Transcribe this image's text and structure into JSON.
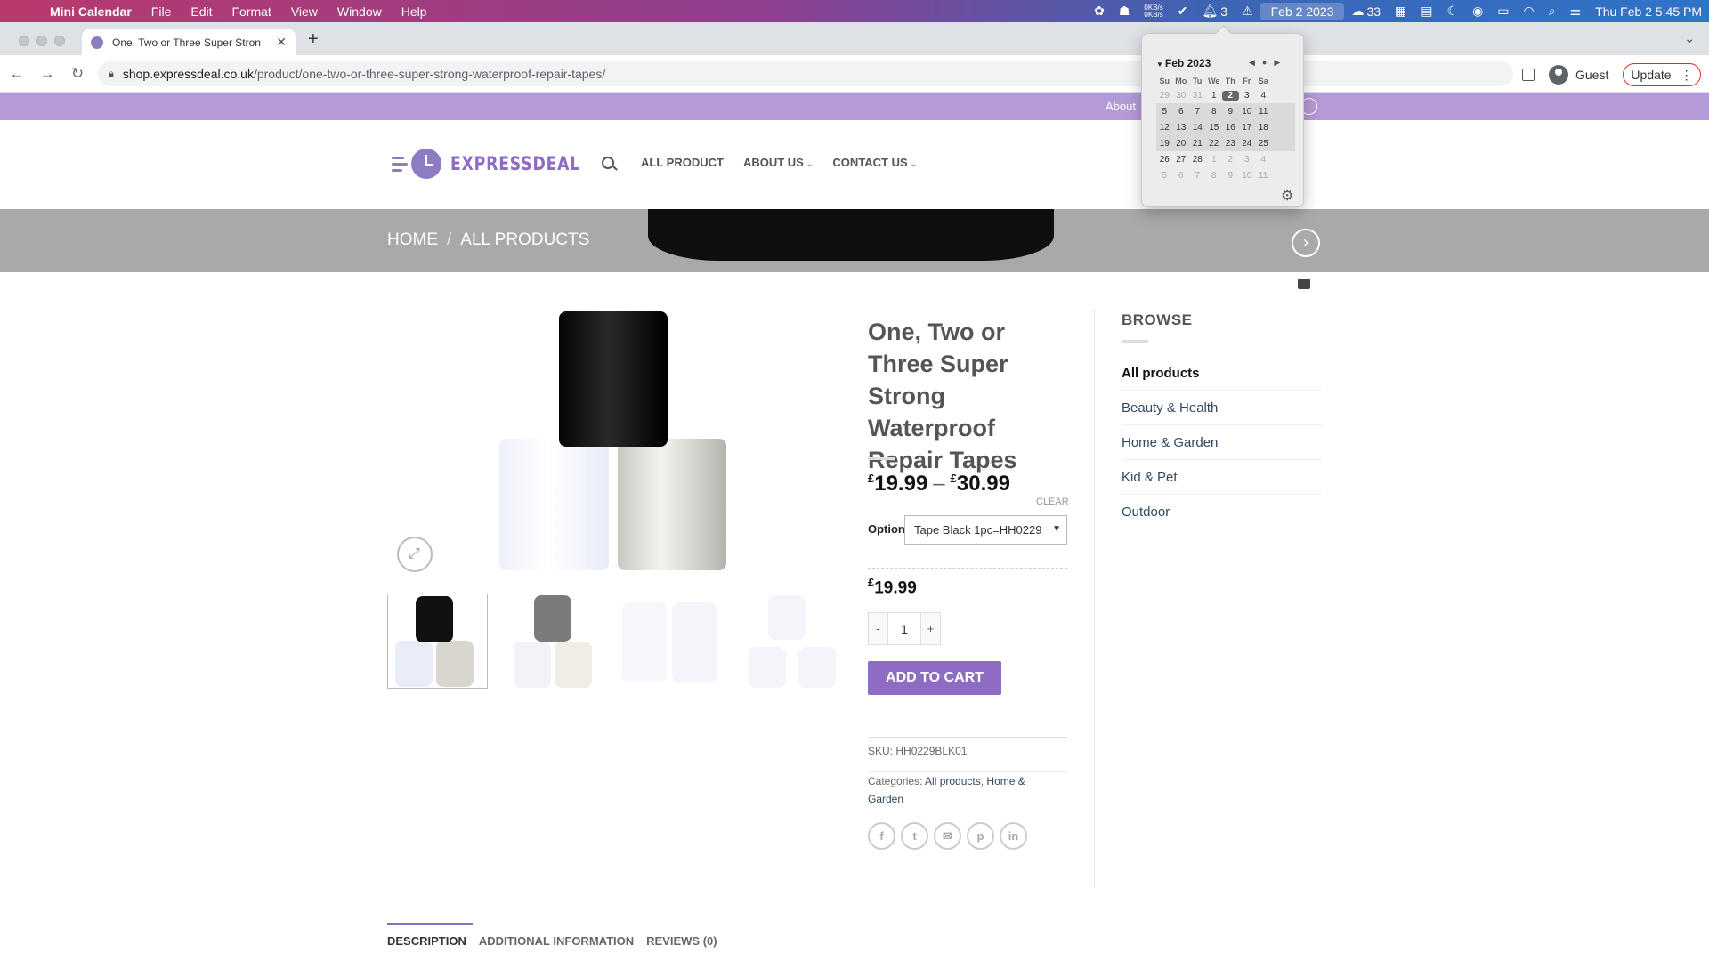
{
  "menubar": {
    "app": "Mini Calendar",
    "menus": [
      "File",
      "Edit",
      "Format",
      "View",
      "Window",
      "Help"
    ],
    "net_up": "0KB/s",
    "net_down": "0KB/s",
    "notif_count": "3",
    "date_chip": "Feb 2 2023",
    "wechat_count": "33",
    "clock": "Thu Feb 2  5:45 PM"
  },
  "browser": {
    "tab_title": "One, Two or Three Super Stron",
    "url_host": "shop.expressdeal.co.uk",
    "url_path": "/product/one-two-or-three-super-strong-waterproof-repair-tapes/",
    "profile": "Guest",
    "update": "Update"
  },
  "site": {
    "topbar_about": "About",
    "logo_text": "EXPRESSDEAL",
    "nav": [
      "ALL PRODUCT",
      "ABOUT US",
      "CONTACT US"
    ],
    "breadcrumb": [
      "HOME",
      "ALL PRODUCTS"
    ]
  },
  "product": {
    "title": "One, Two or Three Super Strong Waterproof Repair Tapes",
    "currency": "£",
    "price_min": "19.99",
    "price_sep": "–",
    "price_max": "30.99",
    "clear": "CLEAR",
    "option_label": "Option",
    "option_selected": "Tape Black 1pc=HH0229",
    "selected_price": "19.99",
    "qty_minus": "-",
    "qty": "1",
    "qty_plus": "+",
    "add_to_cart": "ADD TO CART",
    "sku_label": "SKU:",
    "sku": "HH0229BLK01",
    "categories_label": "Categories:",
    "categories": [
      "All products",
      "Home &",
      "Garden"
    ],
    "share": [
      "f",
      "t",
      "✉",
      "p",
      "in"
    ]
  },
  "sidebar": {
    "title": "BROWSE",
    "items": [
      "All products",
      "Beauty & Health",
      "Home & Garden",
      "Kid & Pet",
      "Outdoor"
    ]
  },
  "tabs": [
    "DESCRIPTION",
    "ADDITIONAL INFORMATION",
    "REVIEWS (0)"
  ],
  "calendar": {
    "month": "Feb 2023",
    "weekdays": [
      "Su",
      "Mo",
      "Tu",
      "We",
      "Th",
      "Fr",
      "Sa"
    ],
    "weeks": [
      [
        "29",
        "30",
        "31",
        "1",
        "2",
        "3",
        "4"
      ],
      [
        "5",
        "6",
        "7",
        "8",
        "9",
        "10",
        "11"
      ],
      [
        "12",
        "13",
        "14",
        "15",
        "16",
        "17",
        "18"
      ],
      [
        "19",
        "20",
        "21",
        "22",
        "23",
        "24",
        "25"
      ],
      [
        "26",
        "27",
        "28",
        "1",
        "2",
        "3",
        "4"
      ],
      [
        "5",
        "6",
        "7",
        "8",
        "9",
        "10",
        "11"
      ]
    ],
    "today": "2"
  }
}
